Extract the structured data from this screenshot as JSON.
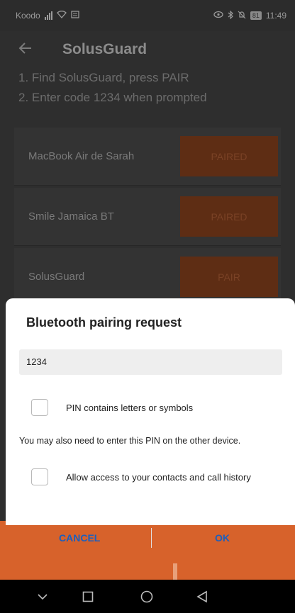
{
  "status_bar": {
    "carrier": "Koodo",
    "battery": "81",
    "time": "11:49"
  },
  "app": {
    "title": "SolusGuard",
    "instructions": [
      "1. Find SolusGuard, press PAIR",
      "2. Enter code 1234 when prompted"
    ],
    "devices": [
      {
        "name": "MacBook Air de Sarah",
        "button": "PAIRED"
      },
      {
        "name": "Smile Jamaica  BT",
        "button": "PAIRED"
      },
      {
        "name": "SolusGuard",
        "button": "PAIR"
      }
    ]
  },
  "dialog": {
    "title": "Bluetooth pairing request",
    "pin_value": "1234",
    "pin_letters_label": "PIN contains letters or symbols",
    "info": "You may also need to enter this PIN on the other device.",
    "contacts_label": "Allow access to your contacts and call history",
    "cancel": "CANCEL",
    "ok": "OK"
  },
  "nav_bar": {
    "icons": [
      "chevron-down-icon",
      "recents-square-icon",
      "home-circle-icon",
      "back-triangle-icon"
    ]
  },
  "colors": {
    "accent_orange": "#d7622b",
    "dialog_button_blue": "#1a5fbf"
  }
}
